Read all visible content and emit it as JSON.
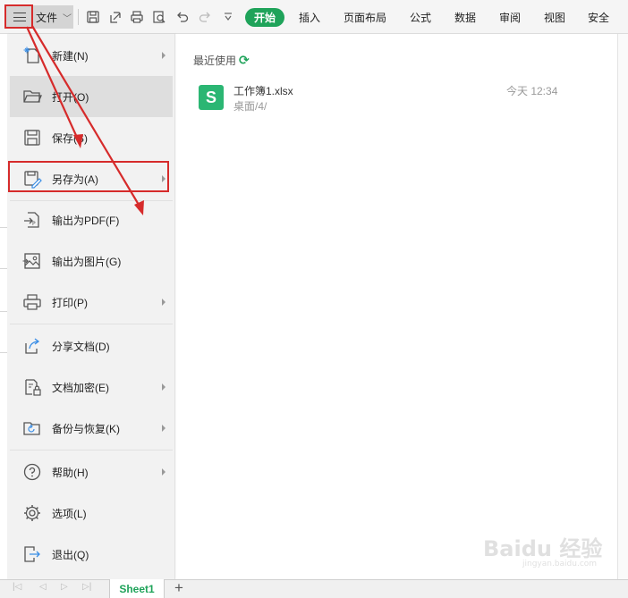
{
  "toolbar": {
    "file_label": "文件",
    "tabs": [
      "开始",
      "插入",
      "页面布局",
      "公式",
      "数据",
      "审阅",
      "视图",
      "安全"
    ],
    "icons": [
      "save-icon",
      "export-icon",
      "print-icon",
      "print-preview-icon",
      "undo-icon",
      "redo-icon",
      "more-dropdown-icon"
    ]
  },
  "menu": {
    "items": [
      {
        "label": "新建(N)",
        "icon": "new-file-icon",
        "submenu": true
      },
      {
        "label": "打开(O)",
        "icon": "open-folder-icon",
        "submenu": false,
        "selected": true
      },
      {
        "label": "保存(S)",
        "icon": "save-icon",
        "submenu": false
      },
      {
        "label": "另存为(A)",
        "icon": "save-as-icon",
        "submenu": true
      },
      {
        "label": "输出为PDF(F)",
        "icon": "export-pdf-icon",
        "submenu": false
      },
      {
        "label": "输出为图片(G)",
        "icon": "export-image-icon",
        "submenu": false
      },
      {
        "label": "打印(P)",
        "icon": "printer-icon",
        "submenu": true
      },
      {
        "label": "分享文档(D)",
        "icon": "share-icon",
        "submenu": false
      },
      {
        "label": "文档加密(E)",
        "icon": "encrypt-icon",
        "submenu": true
      },
      {
        "label": "备份与恢复(K)",
        "icon": "backup-icon",
        "submenu": true
      },
      {
        "label": "帮助(H)",
        "icon": "help-icon",
        "submenu": true
      },
      {
        "label": "选项(L)",
        "icon": "settings-gear-icon",
        "submenu": false
      },
      {
        "label": "退出(Q)",
        "icon": "exit-icon",
        "submenu": false
      }
    ]
  },
  "recent": {
    "title": "最近使用",
    "files": [
      {
        "name": "工作簿1.xlsx",
        "path": "桌面/4/",
        "time": "今天 12:34",
        "icon_letter": "S"
      }
    ]
  },
  "sheetbar": {
    "active_sheet": "Sheet1"
  },
  "watermark": {
    "text": "Baidu 经验",
    "url": "jingyan.baidu.com"
  },
  "colors": {
    "accent_green": "#1fa35a",
    "annotation_red": "#d62b2b"
  }
}
